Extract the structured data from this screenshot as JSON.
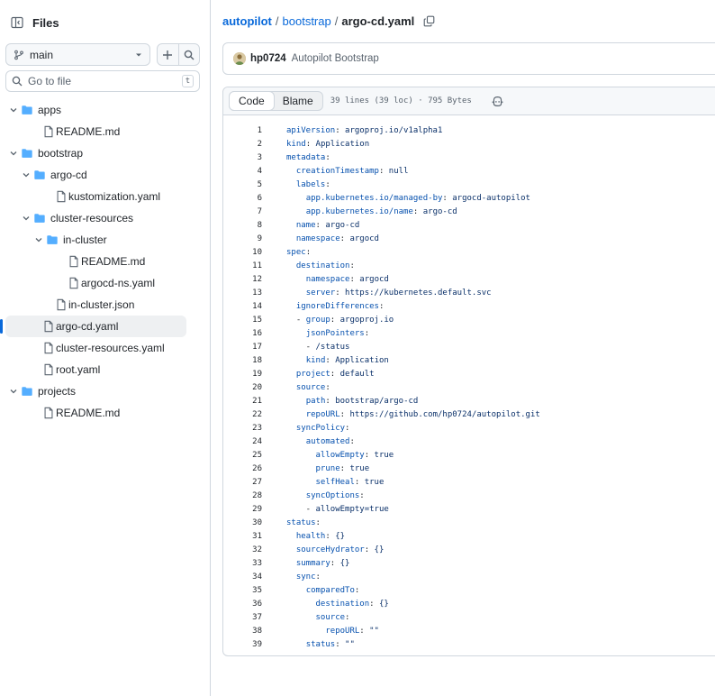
{
  "sidebar": {
    "title": "Files",
    "branch": "main",
    "search_placeholder": "Go to file",
    "search_shortcut": "t",
    "tree": [
      {
        "label": "apps",
        "type": "folder",
        "depth": 0,
        "expanded": true
      },
      {
        "label": "README.md",
        "type": "file",
        "depth": 1
      },
      {
        "label": "bootstrap",
        "type": "folder",
        "depth": 0,
        "expanded": true
      },
      {
        "label": "argo-cd",
        "type": "folder",
        "depth": 1,
        "expanded": true
      },
      {
        "label": "kustomization.yaml",
        "type": "file",
        "depth": 2
      },
      {
        "label": "cluster-resources",
        "type": "folder",
        "depth": 1,
        "expanded": true
      },
      {
        "label": "in-cluster",
        "type": "folder",
        "depth": 2,
        "expanded": true
      },
      {
        "label": "README.md",
        "type": "file",
        "depth": 3
      },
      {
        "label": "argocd-ns.yaml",
        "type": "file",
        "depth": 3
      },
      {
        "label": "in-cluster.json",
        "type": "file",
        "depth": 2
      },
      {
        "label": "argo-cd.yaml",
        "type": "file",
        "depth": 1,
        "selected": true
      },
      {
        "label": "cluster-resources.yaml",
        "type": "file",
        "depth": 1
      },
      {
        "label": "root.yaml",
        "type": "file",
        "depth": 1
      },
      {
        "label": "projects",
        "type": "folder",
        "depth": 0,
        "expanded": true
      },
      {
        "label": "README.md",
        "type": "file",
        "depth": 1
      }
    ]
  },
  "breadcrumb": {
    "repo": "autopilot",
    "folder": "bootstrap",
    "file": "argo-cd.yaml",
    "separator": "/"
  },
  "commit": {
    "author": "hp0724",
    "message": "Autopilot Bootstrap"
  },
  "file": {
    "tab_code": "Code",
    "tab_blame": "Blame",
    "meta": "39 lines (39 loc) · 795 Bytes",
    "lines": [
      "apiVersion: argoproj.io/v1alpha1",
      "kind: Application",
      "metadata:",
      "  creationTimestamp: null",
      "  labels:",
      "    app.kubernetes.io/managed-by: argocd-autopilot",
      "    app.kubernetes.io/name: argo-cd",
      "  name: argo-cd",
      "  namespace: argocd",
      "spec:",
      "  destination:",
      "    namespace: argocd",
      "    server: https://kubernetes.default.svc",
      "  ignoreDifferences:",
      "  - group: argoproj.io",
      "    jsonPointers:",
      "    - /status",
      "    kind: Application",
      "  project: default",
      "  source:",
      "    path: bootstrap/argo-cd",
      "    repoURL: https://github.com/hp0724/autopilot.git",
      "  syncPolicy:",
      "    automated:",
      "      allowEmpty: true",
      "      prune: true",
      "      selfHeal: true",
      "    syncOptions:",
      "    - allowEmpty=true",
      "status:",
      "  health: {}",
      "  sourceHydrator: {}",
      "  summary: {}",
      "  sync:",
      "    comparedTo:",
      "      destination: {}",
      "      source:",
      "        repoURL: \"\"",
      "    status: \"\""
    ]
  },
  "colors": {
    "accent": "#0969da",
    "folder": "#54aeff",
    "border": "#d0d7de",
    "muted": "#59636e"
  }
}
